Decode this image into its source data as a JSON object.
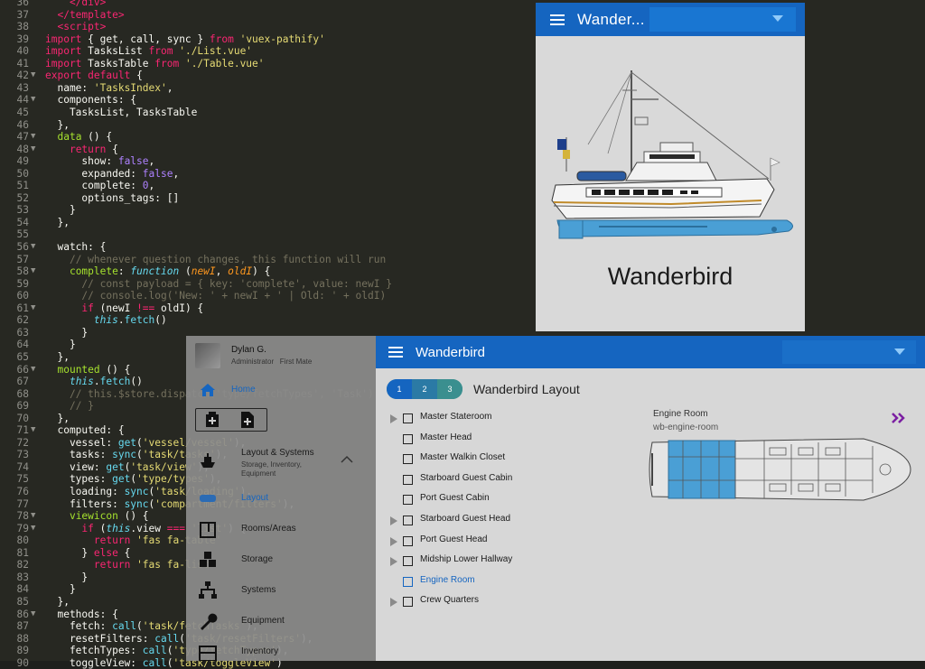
{
  "editor": {
    "lines": [
      {
        "n": "36",
        "fold": false,
        "html": "    &lt;/div&gt;",
        "cls": "k"
      },
      {
        "n": "37",
        "fold": false,
        "html": "  &lt;/template&gt;",
        "cls": "k"
      },
      {
        "n": "38",
        "fold": false,
        "html": "  &lt;script&gt;",
        "cls": "k"
      },
      {
        "n": "39",
        "html": "<span class='k'>import</span> { get, call, sync } <span class='k'>from</span> <span class='s'>'vuex-pathify'</span>"
      },
      {
        "n": "40",
        "html": "<span class='k'>import</span> TasksList <span class='k'>from</span> <span class='s'>'./List.vue'</span>"
      },
      {
        "n": "41",
        "html": "<span class='k'>import</span> TasksTable <span class='k'>from</span> <span class='s'>'./Table.vue'</span>"
      },
      {
        "n": "42",
        "fold": true,
        "html": "<span class='k'>export</span> <span class='k'>default</span> {"
      },
      {
        "n": "43",
        "html": "  name: <span class='s'>'TasksIndex'</span>,"
      },
      {
        "n": "44",
        "fold": true,
        "html": "  components: {"
      },
      {
        "n": "45",
        "html": "    TasksList, TasksTable"
      },
      {
        "n": "46",
        "html": "  },"
      },
      {
        "n": "47",
        "fold": true,
        "html": "  <span class='g'>data</span> () {"
      },
      {
        "n": "48",
        "fold": true,
        "html": "    <span class='k'>return</span> {"
      },
      {
        "n": "49",
        "html": "      show: <span class='n'>false</span>,"
      },
      {
        "n": "50",
        "html": "      expanded: <span class='n'>false</span>,"
      },
      {
        "n": "51",
        "html": "      complete: <span class='n'>0</span>,"
      },
      {
        "n": "52",
        "html": "      options_tags: []"
      },
      {
        "n": "53",
        "html": "    }"
      },
      {
        "n": "54",
        "html": "  },"
      },
      {
        "n": "55",
        "html": ""
      },
      {
        "n": "56",
        "fold": true,
        "html": "  watch: {"
      },
      {
        "n": "57",
        "html": "    <span class='c'>// whenever question changes, this function will run</span>"
      },
      {
        "n": "58",
        "fold": true,
        "html": "    <span class='g'>complete</span>: <span class='i'>function</span> (<span class='a'>newI</span>, <span class='a'>oldI</span>) {"
      },
      {
        "n": "59",
        "html": "      <span class='c'>// const payload = { key: 'complete', value: newI }</span>"
      },
      {
        "n": "60",
        "html": "      <span class='c'>// console.log('New: ' + newI + ' | Old: ' + oldI)</span>"
      },
      {
        "n": "61",
        "fold": true,
        "html": "      <span class='k'>if</span> (newI <span class='k'>!==</span> oldI) {"
      },
      {
        "n": "62",
        "html": "        <span class='i'>this</span>.<span class='f'>fetch</span>()"
      },
      {
        "n": "63",
        "html": "      }"
      },
      {
        "n": "64",
        "html": "    }"
      },
      {
        "n": "65",
        "html": "  },"
      },
      {
        "n": "66",
        "fold": true,
        "html": "  <span class='g'>mounted</span> () {"
      },
      {
        "n": "67",
        "html": "    <span class='i'>this</span>.<span class='f'>fetch</span>()"
      },
      {
        "n": "68",
        "html": "    <span class='c'>// this.$store.dispatch('type/fetchTypes', 'Task')</span>"
      },
      {
        "n": "69",
        "html": "    <span class='c'>// }</span>"
      },
      {
        "n": "70",
        "html": "  },"
      },
      {
        "n": "71",
        "fold": true,
        "html": "  computed: {"
      },
      {
        "n": "72",
        "html": "    vessel: <span class='f'>get</span>(<span class='s'>'vessel/vessel'</span>),"
      },
      {
        "n": "73",
        "html": "    tasks: <span class='f'>sync</span>(<span class='s'>'task/tasks'</span>),"
      },
      {
        "n": "74",
        "html": "    view: <span class='f'>get</span>(<span class='s'>'task/view'</span>),"
      },
      {
        "n": "75",
        "html": "    types: <span class='f'>get</span>(<span class='s'>'type/types'</span>),"
      },
      {
        "n": "76",
        "html": "    loading: <span class='f'>sync</span>(<span class='s'>'task/loading'</span>),"
      },
      {
        "n": "77",
        "html": "    filters: <span class='f'>sync</span>(<span class='s'>'compartment/filters'</span>),"
      },
      {
        "n": "78",
        "fold": true,
        "html": "    <span class='g'>viewicon</span> () {"
      },
      {
        "n": "79",
        "fold": true,
        "html": "      <span class='k'>if</span> (<span class='i'>this</span>.view <span class='k'>===</span> <span class='s'>'list'</span>) {"
      },
      {
        "n": "80",
        "html": "        <span class='k'>return</span> <span class='s'>'fas fa-table'</span>"
      },
      {
        "n": "81",
        "html": "      } <span class='k'>else</span> {"
      },
      {
        "n": "82",
        "html": "        <span class='k'>return</span> <span class='s'>'fas fa-list'</span>"
      },
      {
        "n": "83",
        "html": "      }"
      },
      {
        "n": "84",
        "html": "    }"
      },
      {
        "n": "85",
        "html": "  },"
      },
      {
        "n": "86",
        "fold": true,
        "html": "  methods: {"
      },
      {
        "n": "87",
        "html": "    fetch: <span class='f'>call</span>(<span class='s'>'task/fetchTasks'</span>),"
      },
      {
        "n": "88",
        "html": "    resetFilters: <span class='f'>call</span>(<span class='s'>'task/resetFilters'</span>),"
      },
      {
        "n": "89",
        "html": "    fetchTypes: <span class='f'>call</span>(<span class='s'>'type/fetchTypes'</span>),"
      },
      {
        "n": "90",
        "html": "    toggleView: <span class='f'>call</span>(<span class='s'>'task/toggleView'</span>)"
      }
    ]
  },
  "vessel_window": {
    "title": "Wander...",
    "vessel_name": "Wanderbird"
  },
  "app": {
    "user": {
      "name": "Dylan G.",
      "roles": "Administrator   First Mate"
    },
    "nav": {
      "home": "Home",
      "layout_systems": "Layout & Systems",
      "layout_systems_sub": "Storage, Inventory, Equipment",
      "layout": "Layout",
      "rooms": "Rooms/Areas",
      "storage": "Storage",
      "systems": "Systems",
      "equipment": "Equipment",
      "inventory": "Inventory"
    },
    "appbar_title": "Wanderbird",
    "steps": [
      "1",
      "2",
      "3"
    ],
    "page_title": "Wanderbird Layout",
    "rooms": [
      {
        "label": "Master Stateroom",
        "expandable": true,
        "selected": false
      },
      {
        "label": "Master Head",
        "expandable": false,
        "selected": false
      },
      {
        "label": "Master Walkin Closet",
        "expandable": false,
        "selected": false
      },
      {
        "label": "Starboard Guest Cabin",
        "expandable": false,
        "selected": false
      },
      {
        "label": "Port Guest Cabin",
        "expandable": false,
        "selected": false
      },
      {
        "label": "Starboard Guest Head",
        "expandable": true,
        "selected": false
      },
      {
        "label": "Port Guest Head",
        "expandable": true,
        "selected": false
      },
      {
        "label": "Midship Lower Hallway",
        "expandable": true,
        "selected": false
      },
      {
        "label": "Engine Room",
        "expandable": false,
        "selected": true
      },
      {
        "label": "Crew Quarters",
        "expandable": true,
        "selected": false
      }
    ],
    "detail": {
      "title": "Engine Room",
      "slug": "wb-engine-room"
    }
  },
  "colors": {
    "appbar": "#1565c0",
    "accent": "#7b1fa2",
    "highlight": "#4a9fd5"
  }
}
